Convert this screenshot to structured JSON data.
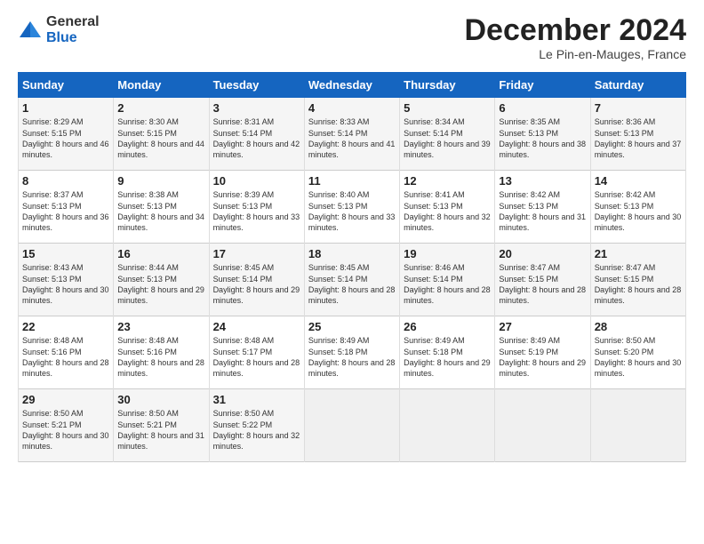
{
  "header": {
    "logo_general": "General",
    "logo_blue": "Blue",
    "month_title": "December 2024",
    "location": "Le Pin-en-Mauges, France"
  },
  "days_of_week": [
    "Sunday",
    "Monday",
    "Tuesday",
    "Wednesday",
    "Thursday",
    "Friday",
    "Saturday"
  ],
  "weeks": [
    [
      {
        "day": "1",
        "sunrise": "Sunrise: 8:29 AM",
        "sunset": "Sunset: 5:15 PM",
        "daylight": "Daylight: 8 hours and 46 minutes."
      },
      {
        "day": "2",
        "sunrise": "Sunrise: 8:30 AM",
        "sunset": "Sunset: 5:15 PM",
        "daylight": "Daylight: 8 hours and 44 minutes."
      },
      {
        "day": "3",
        "sunrise": "Sunrise: 8:31 AM",
        "sunset": "Sunset: 5:14 PM",
        "daylight": "Daylight: 8 hours and 42 minutes."
      },
      {
        "day": "4",
        "sunrise": "Sunrise: 8:33 AM",
        "sunset": "Sunset: 5:14 PM",
        "daylight": "Daylight: 8 hours and 41 minutes."
      },
      {
        "day": "5",
        "sunrise": "Sunrise: 8:34 AM",
        "sunset": "Sunset: 5:14 PM",
        "daylight": "Daylight: 8 hours and 39 minutes."
      },
      {
        "day": "6",
        "sunrise": "Sunrise: 8:35 AM",
        "sunset": "Sunset: 5:13 PM",
        "daylight": "Daylight: 8 hours and 38 minutes."
      },
      {
        "day": "7",
        "sunrise": "Sunrise: 8:36 AM",
        "sunset": "Sunset: 5:13 PM",
        "daylight": "Daylight: 8 hours and 37 minutes."
      }
    ],
    [
      {
        "day": "8",
        "sunrise": "Sunrise: 8:37 AM",
        "sunset": "Sunset: 5:13 PM",
        "daylight": "Daylight: 8 hours and 36 minutes."
      },
      {
        "day": "9",
        "sunrise": "Sunrise: 8:38 AM",
        "sunset": "Sunset: 5:13 PM",
        "daylight": "Daylight: 8 hours and 34 minutes."
      },
      {
        "day": "10",
        "sunrise": "Sunrise: 8:39 AM",
        "sunset": "Sunset: 5:13 PM",
        "daylight": "Daylight: 8 hours and 33 minutes."
      },
      {
        "day": "11",
        "sunrise": "Sunrise: 8:40 AM",
        "sunset": "Sunset: 5:13 PM",
        "daylight": "Daylight: 8 hours and 33 minutes."
      },
      {
        "day": "12",
        "sunrise": "Sunrise: 8:41 AM",
        "sunset": "Sunset: 5:13 PM",
        "daylight": "Daylight: 8 hours and 32 minutes."
      },
      {
        "day": "13",
        "sunrise": "Sunrise: 8:42 AM",
        "sunset": "Sunset: 5:13 PM",
        "daylight": "Daylight: 8 hours and 31 minutes."
      },
      {
        "day": "14",
        "sunrise": "Sunrise: 8:42 AM",
        "sunset": "Sunset: 5:13 PM",
        "daylight": "Daylight: 8 hours and 30 minutes."
      }
    ],
    [
      {
        "day": "15",
        "sunrise": "Sunrise: 8:43 AM",
        "sunset": "Sunset: 5:13 PM",
        "daylight": "Daylight: 8 hours and 30 minutes."
      },
      {
        "day": "16",
        "sunrise": "Sunrise: 8:44 AM",
        "sunset": "Sunset: 5:13 PM",
        "daylight": "Daylight: 8 hours and 29 minutes."
      },
      {
        "day": "17",
        "sunrise": "Sunrise: 8:45 AM",
        "sunset": "Sunset: 5:14 PM",
        "daylight": "Daylight: 8 hours and 29 minutes."
      },
      {
        "day": "18",
        "sunrise": "Sunrise: 8:45 AM",
        "sunset": "Sunset: 5:14 PM",
        "daylight": "Daylight: 8 hours and 28 minutes."
      },
      {
        "day": "19",
        "sunrise": "Sunrise: 8:46 AM",
        "sunset": "Sunset: 5:14 PM",
        "daylight": "Daylight: 8 hours and 28 minutes."
      },
      {
        "day": "20",
        "sunrise": "Sunrise: 8:47 AM",
        "sunset": "Sunset: 5:15 PM",
        "daylight": "Daylight: 8 hours and 28 minutes."
      },
      {
        "day": "21",
        "sunrise": "Sunrise: 8:47 AM",
        "sunset": "Sunset: 5:15 PM",
        "daylight": "Daylight: 8 hours and 28 minutes."
      }
    ],
    [
      {
        "day": "22",
        "sunrise": "Sunrise: 8:48 AM",
        "sunset": "Sunset: 5:16 PM",
        "daylight": "Daylight: 8 hours and 28 minutes."
      },
      {
        "day": "23",
        "sunrise": "Sunrise: 8:48 AM",
        "sunset": "Sunset: 5:16 PM",
        "daylight": "Daylight: 8 hours and 28 minutes."
      },
      {
        "day": "24",
        "sunrise": "Sunrise: 8:48 AM",
        "sunset": "Sunset: 5:17 PM",
        "daylight": "Daylight: 8 hours and 28 minutes."
      },
      {
        "day": "25",
        "sunrise": "Sunrise: 8:49 AM",
        "sunset": "Sunset: 5:18 PM",
        "daylight": "Daylight: 8 hours and 28 minutes."
      },
      {
        "day": "26",
        "sunrise": "Sunrise: 8:49 AM",
        "sunset": "Sunset: 5:18 PM",
        "daylight": "Daylight: 8 hours and 29 minutes."
      },
      {
        "day": "27",
        "sunrise": "Sunrise: 8:49 AM",
        "sunset": "Sunset: 5:19 PM",
        "daylight": "Daylight: 8 hours and 29 minutes."
      },
      {
        "day": "28",
        "sunrise": "Sunrise: 8:50 AM",
        "sunset": "Sunset: 5:20 PM",
        "daylight": "Daylight: 8 hours and 30 minutes."
      }
    ],
    [
      {
        "day": "29",
        "sunrise": "Sunrise: 8:50 AM",
        "sunset": "Sunset: 5:21 PM",
        "daylight": "Daylight: 8 hours and 30 minutes."
      },
      {
        "day": "30",
        "sunrise": "Sunrise: 8:50 AM",
        "sunset": "Sunset: 5:21 PM",
        "daylight": "Daylight: 8 hours and 31 minutes."
      },
      {
        "day": "31",
        "sunrise": "Sunrise: 8:50 AM",
        "sunset": "Sunset: 5:22 PM",
        "daylight": "Daylight: 8 hours and 32 minutes."
      },
      null,
      null,
      null,
      null
    ]
  ]
}
